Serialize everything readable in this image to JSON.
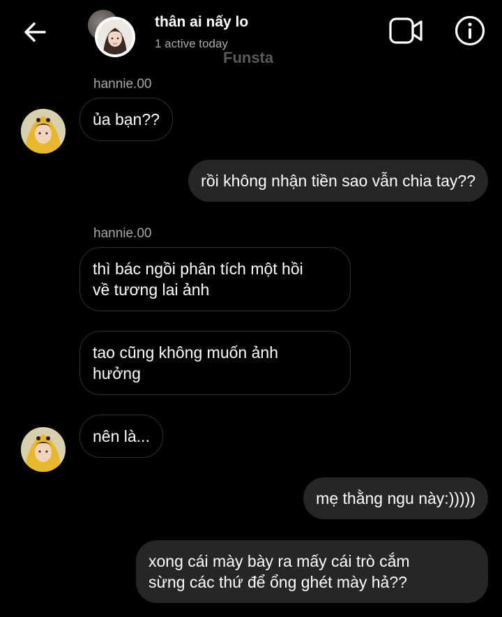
{
  "header": {
    "title": "thân ai nấy lo",
    "subtitle": "1 active today",
    "watermark": "Funsta"
  },
  "messages": [
    {
      "sender": "hannie.00",
      "text": "ủa bạn??",
      "direction": "in"
    },
    {
      "text": "rồi không nhận tiền sao vẫn chia tay??",
      "direction": "out"
    },
    {
      "sender": "hannie.00",
      "text": "thì bác ngồi phân tích một hồi\nvề tương lai ảnh",
      "direction": "in"
    },
    {
      "text": "tao cũng không muốn ảnh\nhưởng",
      "direction": "in"
    },
    {
      "text": "nên là...",
      "direction": "in"
    },
    {
      "text": "mẹ thằng ngu này:)))))",
      "direction": "out"
    },
    {
      "text": "xong cái mày bày ra mấy cái trò cắm\nsừng các thứ để ổng ghét mày hả??",
      "direction": "out"
    }
  ],
  "colors": {
    "background": "#000000",
    "outgoing_bubble": "#262626",
    "incoming_border": "#2f2f2f",
    "muted_text": "#a8a8a8"
  }
}
